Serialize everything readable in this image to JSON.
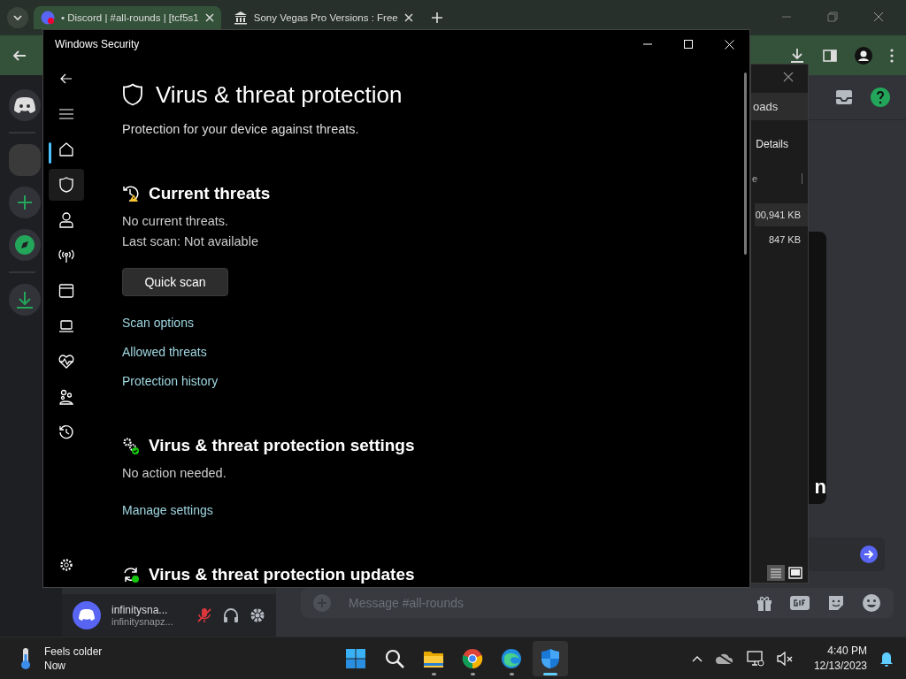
{
  "browser": {
    "tabs": [
      {
        "title": "• Discord | #all-rounds | [tcf5s1",
        "selected": true
      },
      {
        "title": "Sony Vegas Pro Versions : Free",
        "selected": false
      }
    ]
  },
  "discord": {
    "user": {
      "name": "infinitysna...",
      "tag": "infinitysnapz...",
      "muted": true
    },
    "message_placeholder": "Message #all-rounds",
    "embed_text": "n"
  },
  "downloads_window": {
    "tab": "oads",
    "button": "Details",
    "column_header": "e",
    "rows": [
      {
        "size": "00,941 KB",
        "selected": true
      },
      {
        "size": "847 KB",
        "selected": false
      }
    ]
  },
  "security_window": {
    "title": "Windows Security",
    "nav": [
      {
        "kind": "home",
        "selected": true,
        "hovered": false
      },
      {
        "kind": "shield",
        "selected": false,
        "hovered": true
      },
      {
        "kind": "account",
        "selected": false,
        "hovered": false
      },
      {
        "kind": "network",
        "selected": false,
        "hovered": false
      },
      {
        "kind": "app",
        "selected": false,
        "hovered": false
      },
      {
        "kind": "device",
        "selected": false,
        "hovered": false
      },
      {
        "kind": "health",
        "selected": false,
        "hovered": false
      },
      {
        "kind": "family",
        "selected": false,
        "hovered": false
      },
      {
        "kind": "history",
        "selected": false,
        "hovered": false
      }
    ],
    "heading": "Virus & threat protection",
    "subtitle": "Protection for your device against threats.",
    "sections": [
      {
        "kind": "threats",
        "heading": "Current threats",
        "lines": [
          "No current threats.",
          "Last scan: Not available"
        ],
        "button": "Quick scan",
        "links": [
          "Scan options",
          "Allowed threats",
          "Protection history"
        ]
      },
      {
        "kind": "settings",
        "heading": "Virus & threat protection settings",
        "lines": [
          "No action needed."
        ],
        "links": [
          "Manage settings"
        ]
      },
      {
        "kind": "updates",
        "heading": "Virus & threat protection updates"
      }
    ]
  },
  "taskbar": {
    "weather": {
      "title": "Feels colder",
      "subtitle": "Now"
    },
    "apps": [
      {
        "kind": "start",
        "running": false,
        "selected": false
      },
      {
        "kind": "search",
        "running": false,
        "selected": false
      },
      {
        "kind": "explorer",
        "running": true,
        "selected": false
      },
      {
        "kind": "chrome",
        "running": true,
        "selected": false
      },
      {
        "kind": "edge",
        "running": true,
        "selected": false
      },
      {
        "kind": "security",
        "running": true,
        "selected": true
      }
    ],
    "time": "4:40 PM",
    "date": "12/13/2023"
  }
}
